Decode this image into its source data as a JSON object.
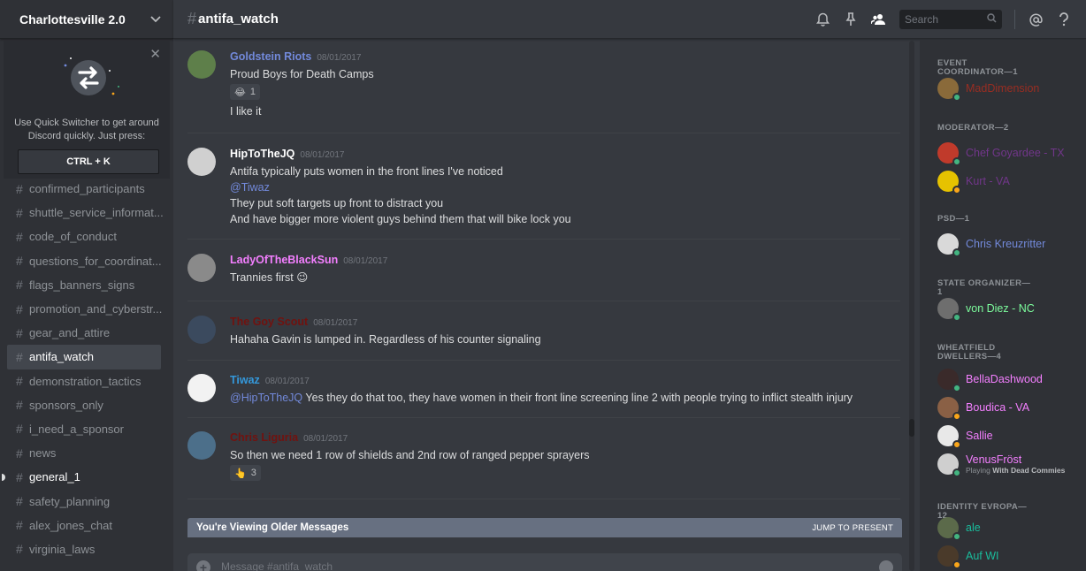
{
  "server": {
    "name": "Charlottesville 2.0"
  },
  "quick_switcher": {
    "text": "Use Quick Switcher to get around Discord quickly. Just press:",
    "shortcut": "CTRL + K"
  },
  "channels": [
    {
      "name": "confirmed_participants",
      "state": "normal"
    },
    {
      "name": "shuttle_service_informat...",
      "state": "normal"
    },
    {
      "name": "code_of_conduct",
      "state": "normal"
    },
    {
      "name": "questions_for_coordinat...",
      "state": "normal"
    },
    {
      "name": "flags_banners_signs",
      "state": "normal"
    },
    {
      "name": "promotion_and_cyberstr...",
      "state": "normal"
    },
    {
      "name": "gear_and_attire",
      "state": "normal"
    },
    {
      "name": "antifa_watch",
      "state": "selected"
    },
    {
      "name": "demonstration_tactics",
      "state": "normal"
    },
    {
      "name": "sponsors_only",
      "state": "normal"
    },
    {
      "name": "i_need_a_sponsor",
      "state": "normal"
    },
    {
      "name": "news",
      "state": "normal"
    },
    {
      "name": "general_1",
      "state": "unread"
    },
    {
      "name": "safety_planning",
      "state": "normal"
    },
    {
      "name": "alex_jones_chat",
      "state": "normal"
    },
    {
      "name": "virginia_laws",
      "state": "normal"
    }
  ],
  "header": {
    "hash": "#",
    "channel": "antifa_watch",
    "search_placeholder": "Search",
    "icons": [
      "bell-icon",
      "pin-icon",
      "members-icon",
      "search-icon",
      "at-icon",
      "help-icon"
    ]
  },
  "messages": [
    {
      "author": "Goldstein Riots",
      "color": "#7289da",
      "timestamp": "08/01/2017",
      "lines": [
        "Proud Boys for Death Camps"
      ],
      "reaction": {
        "emoji": "😂",
        "count": "1"
      },
      "after_reaction": [
        "I like it"
      ],
      "avatar_color": "#5e7f4a"
    },
    {
      "author": "HipToTheJQ",
      "color": "#ffffff",
      "timestamp": "08/01/2017",
      "lines": [
        "Antifa typically puts women in the front lines I've noticed",
        "@Tiwaz",
        "They put soft targets up front to distract you",
        "And have bigger more violent guys behind them that will bike lock you"
      ],
      "avatar_color": "#d0d0d0"
    },
    {
      "author": "LadyOfTheBlackSun",
      "color": "#f47fff",
      "timestamp": "08/01/2017",
      "lines": [
        "Trannies first 😉"
      ],
      "avatar_color": "#8a8a8a"
    },
    {
      "author": "The Goy Scout",
      "color": "#71120f",
      "timestamp": "08/01/2017",
      "lines": [
        "Hahaha Gavin is lumped in. Regardless of his counter signaling"
      ],
      "avatar_color": "#3b4a5e"
    },
    {
      "author": "Tiwaz",
      "color": "#3498db",
      "timestamp": "08/01/2017",
      "mention": "@HipToTheJQ",
      "lines": [
        "Yes they do that too, they have women in their front line screening line 2 with people trying to inflict stealth injury"
      ],
      "avatar_color": "#f2f2f2"
    },
    {
      "author": "Chris Liguria",
      "color": "#71120f",
      "timestamp": "08/01/2017",
      "lines": [
        "So then we need 1 row of shields and 2nd row of ranged pepper sprayers"
      ],
      "reaction": {
        "emoji": "👆",
        "count": "3"
      },
      "avatar_color": "#4c6f8a"
    }
  ],
  "older_bar": {
    "text": "You're Viewing Older Messages",
    "jump": "JUMP TO PRESENT"
  },
  "composer": {
    "placeholder": "Message #antifa_watch"
  },
  "member_groups": [
    {
      "role": "EVENT COORDINATOR—1",
      "members": [
        {
          "name": "MadDimension",
          "color": "#992d22",
          "status": "#43b581",
          "avatar": "#8a6a3a"
        }
      ]
    },
    {
      "role": "MODERATOR—2",
      "members": [
        {
          "name": "Chef Goyardee - TX",
          "color": "#71368a",
          "status": "#43b581",
          "avatar": "#c03a2b"
        },
        {
          "name": "Kurt - VA",
          "color": "#71368a",
          "status": "#faa61a",
          "avatar": "#e6c200"
        }
      ]
    },
    {
      "role": "PSD—1",
      "members": [
        {
          "name": "Chris Kreuzritter",
          "color": "#7289da",
          "status": "#43b581",
          "avatar": "#d9d9d9"
        }
      ]
    },
    {
      "role": "STATE ORGANIZER—1",
      "members": [
        {
          "name": "von Diez - NC",
          "color": "#7cfc9c",
          "status": "#43b581",
          "avatar": "#6e6e6e"
        }
      ]
    },
    {
      "role": "WHEATFIELD DWELLERS—4",
      "members": [
        {
          "name": "BellaDashwood",
          "color": "#f47fff",
          "status": "#43b581",
          "avatar": "#3a2a2a"
        },
        {
          "name": "Boudica - VA",
          "color": "#f47fff",
          "status": "#faa61a",
          "avatar": "#8a6045"
        },
        {
          "name": "Sallie",
          "color": "#f47fff",
          "status": "#faa61a",
          "avatar": "#e8e8e8"
        },
        {
          "name": "VenusFröst",
          "color": "#f47fff",
          "status": "#43b581",
          "avatar": "#cfcfcf",
          "game_prefix": "Playing ",
          "game": "With Dead Commies"
        }
      ]
    },
    {
      "role": "IDENTITY EVROPA—12",
      "members": [
        {
          "name": "ale",
          "color": "#1abc9c",
          "status": "#43b581",
          "avatar": "#5b6a4a"
        },
        {
          "name": "Auf WI",
          "color": "#1abc9c",
          "status": "#faa61a",
          "avatar": "#4a3a2a"
        }
      ]
    }
  ]
}
